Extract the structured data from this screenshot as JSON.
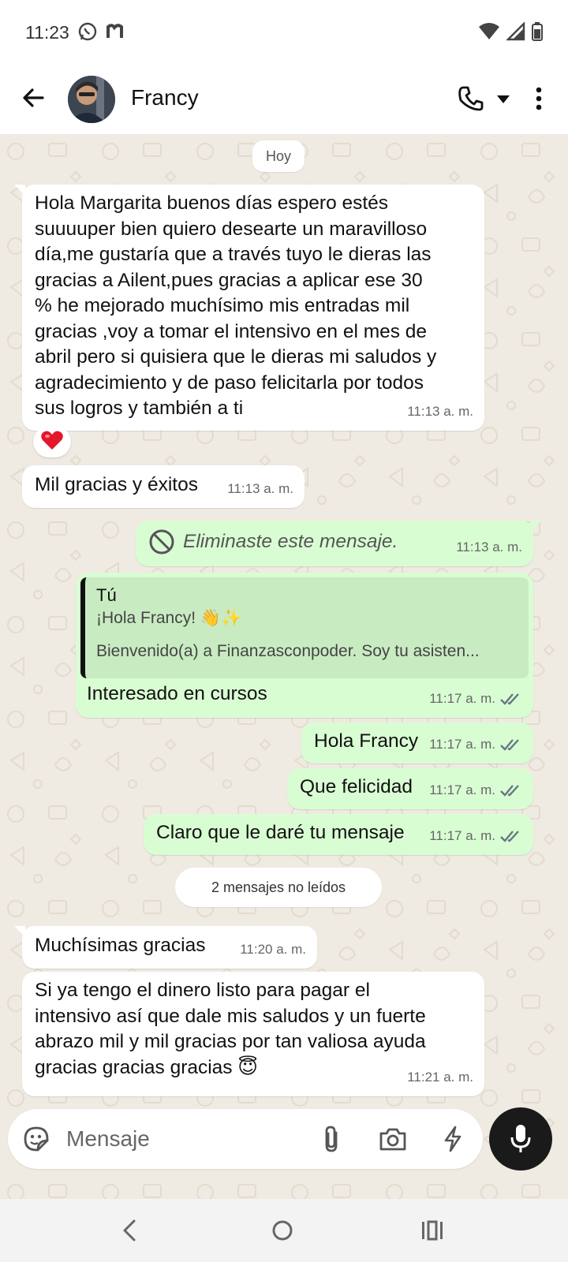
{
  "status_bar": {
    "time": "11:23",
    "left_icons": [
      "whatsapp-notification-icon",
      "m-app-icon"
    ],
    "right_icons": [
      "wifi-icon",
      "signal-icon",
      "battery-icon"
    ]
  },
  "header": {
    "contact_name": "Francy",
    "icons": [
      "back-arrow-icon",
      "phone-icon",
      "chevron-down-icon",
      "more-vert-icon"
    ]
  },
  "chat": {
    "date_pill": "Hoy",
    "messages": [
      {
        "direction": "in",
        "text": "Hola Margarita buenos días espero estés suuuuper bien quiero desearte un maravilloso día,me gustaría que a través tuyo le dieras las gracias a Ailent,pues gracias a aplicar ese 30 % he mejorado muchísimo mis entradas mil gracias ,voy a tomar el intensivo en el mes de abril pero si quisiera que le dieras mi saludos y agradecimiento y de paso felicitarla por todos sus logros y también a ti",
        "lines": [
          "Hola Margarita buenos días espero estés",
          "suuuuper bien quiero desearte un maravilloso",
          "día,me gustaría que a través tuyo le dieras las",
          "gracias a Ailent,pues gracias a aplicar ese 30",
          "% he mejorado muchísimo mis entradas mil",
          "gracias ,voy a tomar el intensivo en el mes de",
          "abril pero si quisiera que le dieras mi saludos y",
          "agradecimiento y de paso felicitarla por todos",
          "sus logros y también a ti"
        ],
        "time": "11:13 a. m.",
        "reaction": "❤️"
      },
      {
        "direction": "in",
        "text": "Mil gracias y éxitos",
        "time": "11:13 a. m."
      },
      {
        "direction": "out",
        "deleted": true,
        "text": "Eliminaste este mensaje.",
        "time": "11:13 a. m."
      },
      {
        "direction": "out",
        "quote": {
          "author": "Tú",
          "line1": "¡Hola Francy! 👋✨",
          "line2": "Bienvenido(a) a Finanzasconpoder. Soy tu asisten..."
        },
        "text": "Interesado en cursos",
        "time": "11:17 a. m.",
        "status": "read"
      },
      {
        "direction": "out",
        "text": "Hola Francy",
        "time": "11:17 a. m.",
        "status": "read"
      },
      {
        "direction": "out",
        "text": "Que felicidad",
        "time": "11:17 a. m.",
        "status": "read"
      },
      {
        "direction": "out",
        "text": "Claro que le daré tu mensaje",
        "time": "11:17 a. m.",
        "status": "read"
      }
    ],
    "unread_pill": "2 mensajes no leídos",
    "unread_messages": [
      {
        "direction": "in",
        "text": "Muchísimas gracias",
        "time": "11:20 a. m."
      },
      {
        "direction": "in",
        "text": "Si ya tengo el dinero listo para pagar el intensivo así que dale mis saludos y un fuerte abrazo mil y mil gracias por tan valiosa ayuda gracias gracias gracias 😇",
        "lines": [
          "Si ya tengo el dinero listo para pagar el",
          "intensivo así que dale mis saludos y un fuerte",
          "abrazo mil y mil gracias por tan valiosa ayuda",
          "gracias gracias gracias 😇"
        ],
        "time": "11:21 a. m."
      }
    ]
  },
  "composer": {
    "placeholder": "Mensaje",
    "icons": [
      "sticker-icon",
      "attach-icon",
      "camera-icon",
      "bolt-icon",
      "mic-icon"
    ]
  },
  "nav_bar": {
    "icons": [
      "nav-back-icon",
      "nav-home-icon",
      "nav-recents-icon"
    ]
  },
  "colors": {
    "chat_background": "#efeae2",
    "incoming_bubble": "#ffffff",
    "outgoing_bubble": "#d9fdd3",
    "quote_background": "#c9ebc2",
    "mic_button": "#1a1a1a"
  }
}
